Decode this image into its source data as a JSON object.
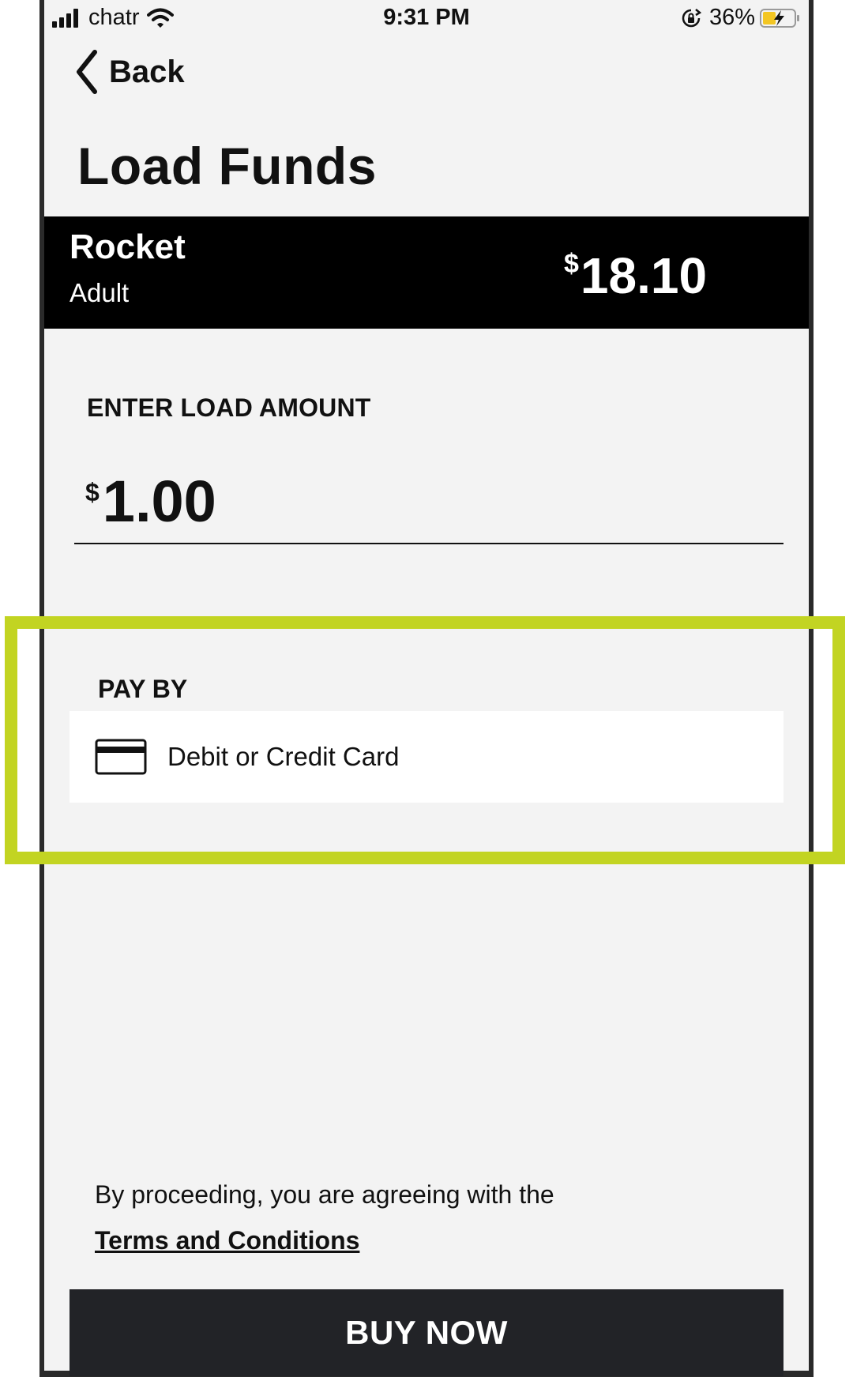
{
  "status_bar": {
    "carrier": "chatr",
    "time": "9:31 PM",
    "battery_percent": "36%",
    "signal_bars": 4,
    "icons": [
      "signal-icon",
      "wifi-icon",
      "orientation-lock-icon",
      "battery-charging-icon"
    ]
  },
  "nav": {
    "back_label": "Back",
    "back_icon": "chevron-left-icon"
  },
  "page": {
    "title": "Load Funds"
  },
  "card": {
    "name": "Rocket",
    "type": "Adult",
    "currency_symbol": "$",
    "balance": "18.10"
  },
  "load": {
    "label": "ENTER LOAD AMOUNT",
    "currency_symbol": "$",
    "amount": "1.00"
  },
  "pay_by": {
    "label": "PAY BY",
    "option_label": "Debit or Credit Card",
    "option_icon": "credit-card-icon"
  },
  "footer": {
    "agree_text": "By proceeding, you are agreeing with the",
    "terms_link": "Terms and Conditions",
    "buy_button": "BUY NOW"
  },
  "colors": {
    "highlight": "#c2d422",
    "card_bar": "#000000",
    "button": "#222327",
    "background": "#f3f3f3"
  }
}
